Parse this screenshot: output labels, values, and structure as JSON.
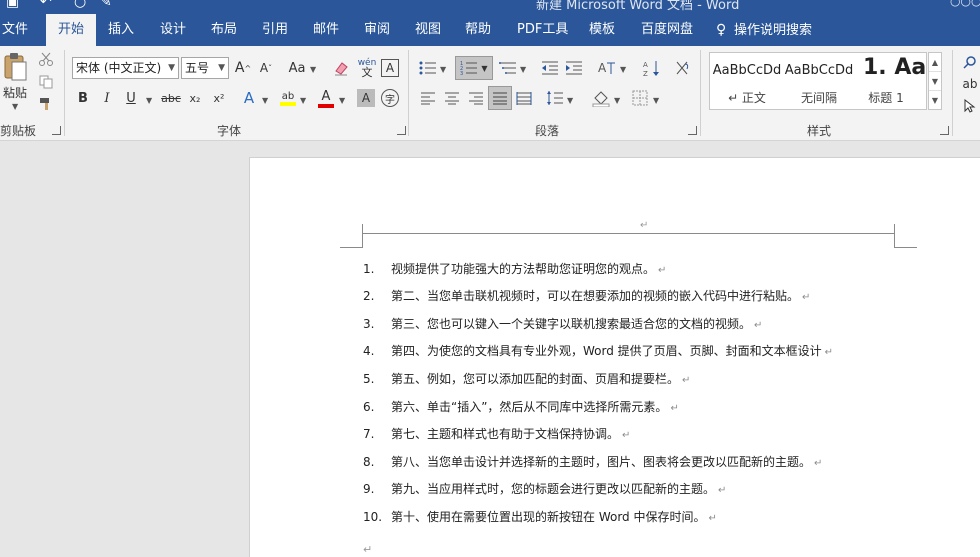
{
  "titlebar": {
    "title": "新建 Microsoft Word 文档 - Word",
    "user": "○○○○○"
  },
  "tabs": {
    "file": "文件",
    "home": "开始",
    "insert": "插入",
    "design": "设计",
    "layout": "布局",
    "references": "引用",
    "mailings": "邮件",
    "review": "审阅",
    "view": "视图",
    "help": "帮助",
    "pdf": "PDF工具",
    "template": "模板",
    "baidu": "百度网盘",
    "tell_me": "操作说明搜索"
  },
  "ribbon": {
    "clipboard": {
      "paste": "粘贴",
      "label": "剪贴板"
    },
    "font": {
      "font_name": "宋体 (中文正文)",
      "font_size": "五号",
      "label": "字体",
      "aa_label": "Aa",
      "bold": "B",
      "italic": "I",
      "underline": "U",
      "strike": "abc",
      "subscript": "x₂",
      "superscript": "x²",
      "text_effect": "A",
      "highlight": "ab",
      "font_color": "A",
      "char_shade": "A",
      "enclose": "字",
      "pinyin": "wén",
      "border": "A",
      "grow": "A",
      "shrink": "A"
    },
    "paragraph": {
      "label": "段落"
    },
    "styles": {
      "label": "样式",
      "items": [
        {
          "preview": "AaBbCcDd",
          "name": "↵ 正文"
        },
        {
          "preview": "AaBbCcDd",
          "name": "无间隔"
        },
        {
          "preview": "1.  Aa",
          "name": "标题 1"
        }
      ]
    }
  },
  "colors": {
    "accent": "#2b579a",
    "highlight_yellow": "#ffff00",
    "font_red": "#e00000"
  },
  "document": {
    "header_mark": "↵",
    "items": [
      {
        "num": "1.",
        "text": "视频提供了功能强大的方法帮助您证明您的观点。"
      },
      {
        "num": "2.",
        "text": "第二、当您单击联机视频时，可以在想要添加的视频的嵌入代码中进行粘贴。"
      },
      {
        "num": "3.",
        "text": "第三、您也可以键入一个关键字以联机搜索最适合您的文档的视频。"
      },
      {
        "num": "4.",
        "text": "第四、为使您的文档具有专业外观，Word 提供了页眉、页脚、封面和文本框设计"
      },
      {
        "num": "5.",
        "text": "第五、例如，您可以添加匹配的封面、页眉和提要栏。"
      },
      {
        "num": "6.",
        "text": "第六、单击“插入”，然后从不同库中选择所需元素。"
      },
      {
        "num": "7.",
        "text": "第七、主题和样式也有助于文档保持协调。"
      },
      {
        "num": "8.",
        "text": "第八、当您单击设计并选择新的主题时，图片、图表将会更改以匹配新的主题。"
      },
      {
        "num": "9.",
        "text": "第九、当应用样式时，您的标题会进行更改以匹配新的主题。"
      },
      {
        "num": "10.",
        "text": "第十、使用在需要位置出现的新按钮在 Word 中保存时间。"
      }
    ],
    "para_mark": "↵"
  }
}
